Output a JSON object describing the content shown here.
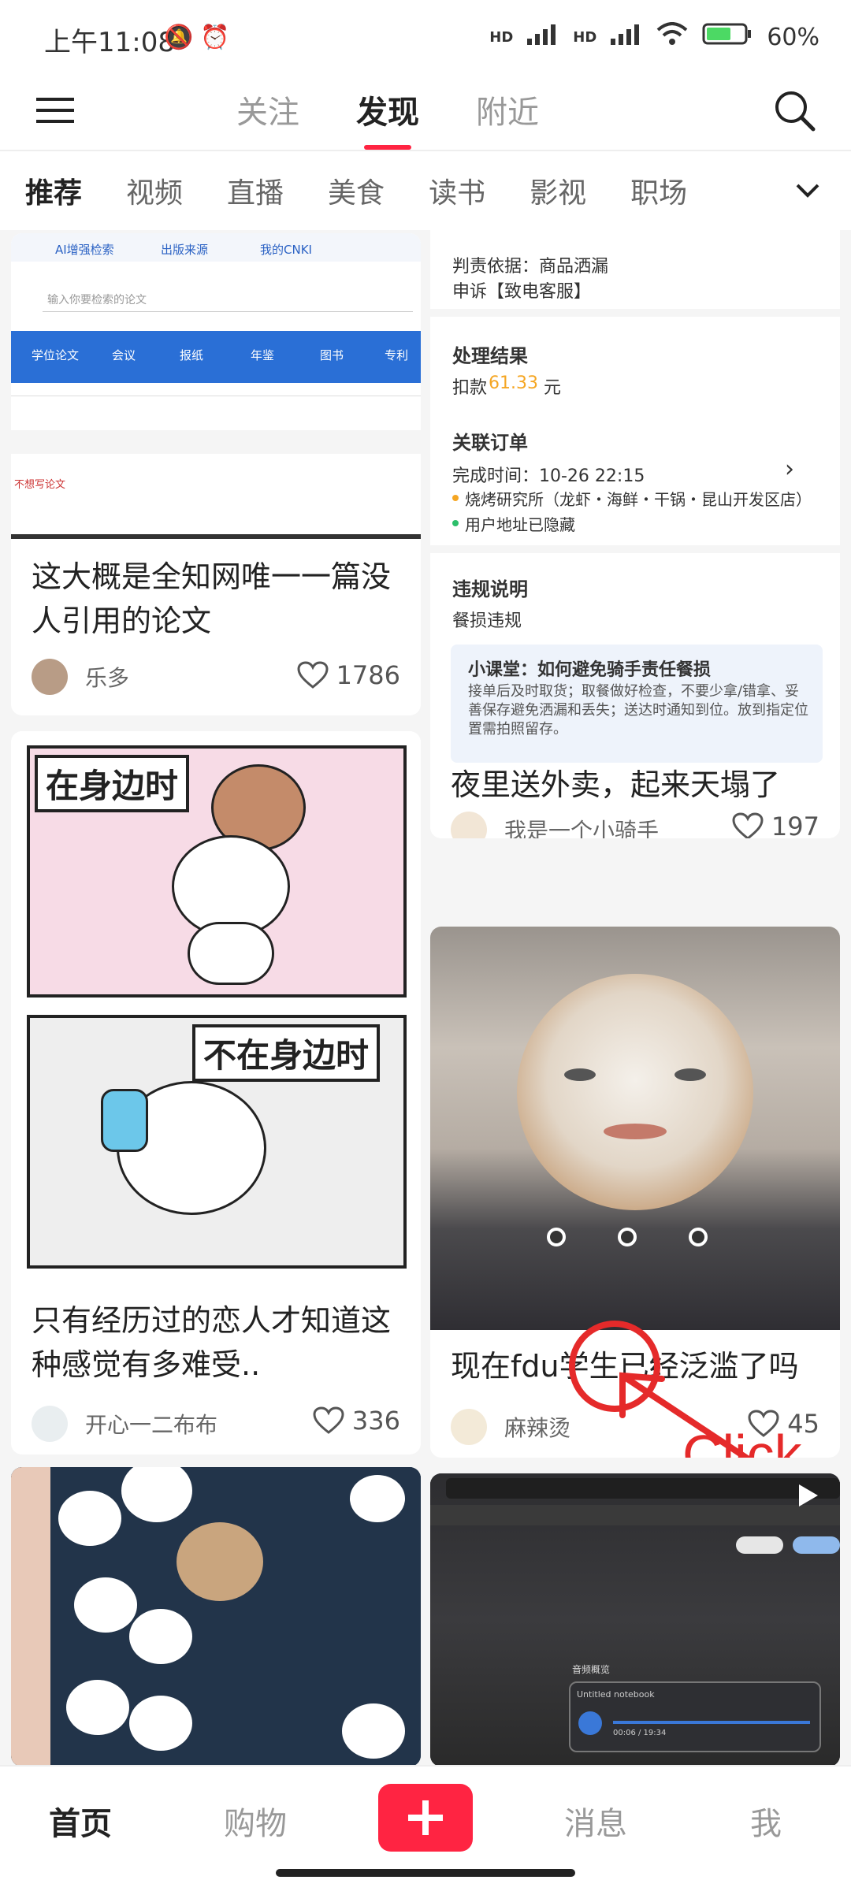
{
  "status": {
    "time": "上午11:08",
    "battery": "60%",
    "signal1": "HD",
    "signal2": "HD"
  },
  "header": {
    "tabs": [
      "关注",
      "发现",
      "附近"
    ],
    "active_tab": "发现"
  },
  "categories": [
    "推荐",
    "视频",
    "直播",
    "美食",
    "读书",
    "影视",
    "职场"
  ],
  "cards": {
    "c1": {
      "title": "这大概是全知网唯一一篇没人引用的论文",
      "author": "乐多",
      "likes": "1786",
      "screenshot_texts": {
        "top1": "AI增强检索",
        "top2": "出版来源",
        "top3": "我的CNKI",
        "search": "输入你要检索的论文",
        "tab1": "学位论文",
        "tab2": "会议",
        "tab3": "报纸",
        "tab4": "年鉴",
        "tab5": "图书",
        "tab6": "专利",
        "row": "不想写论文"
      }
    },
    "c2": {
      "title": "夜里送外卖，起来天塌了",
      "author": "我是一个小骑手",
      "likes": "197",
      "detail": {
        "line1": "判责依据：商品洒漏",
        "line2": "申诉【致电客服】",
        "result_h": "处理结果",
        "deduct_label": "扣款",
        "deduct_amount": "61.33",
        "deduct_unit": "元",
        "order_h": "关联订单",
        "finish_time": "完成时间：10-26 22:15",
        "shop": "烧烤研究所（龙虾・海鲜・干锅・昆山开发区店）",
        "addr": "用户地址已隐藏",
        "vio_h": "违规说明",
        "vio": "餐损违规",
        "tip_h": "小课堂：如何避免骑手责任餐损",
        "tip": "接单后及时取货；取餐做好检查，不要少拿/错拿、妥善保存避免洒漏和丢失；送达时通知到位。放到指定位置需拍照留存。"
      }
    },
    "c3": {
      "title": "只有经历过的恋人才知道这种感觉有多难受..",
      "author": "开心一二布布",
      "likes": "336",
      "tag1": "在身边时",
      "tag2": "不在身边时"
    },
    "c4": {
      "title": "现在fdu学生已经泛滥了吗",
      "author": "麻辣烫",
      "likes": "45",
      "annotation": "Click"
    },
    "c6": {
      "notebook_title": "Untitled notebook",
      "player_time": "00:06 / 19:34",
      "overview": "音频概览"
    }
  },
  "bottom_nav": {
    "home": "首页",
    "shop": "购物",
    "msg": "消息",
    "me": "我"
  },
  "colors": {
    "brand": "#ff2442",
    "accent_orange": "#f5a623"
  }
}
